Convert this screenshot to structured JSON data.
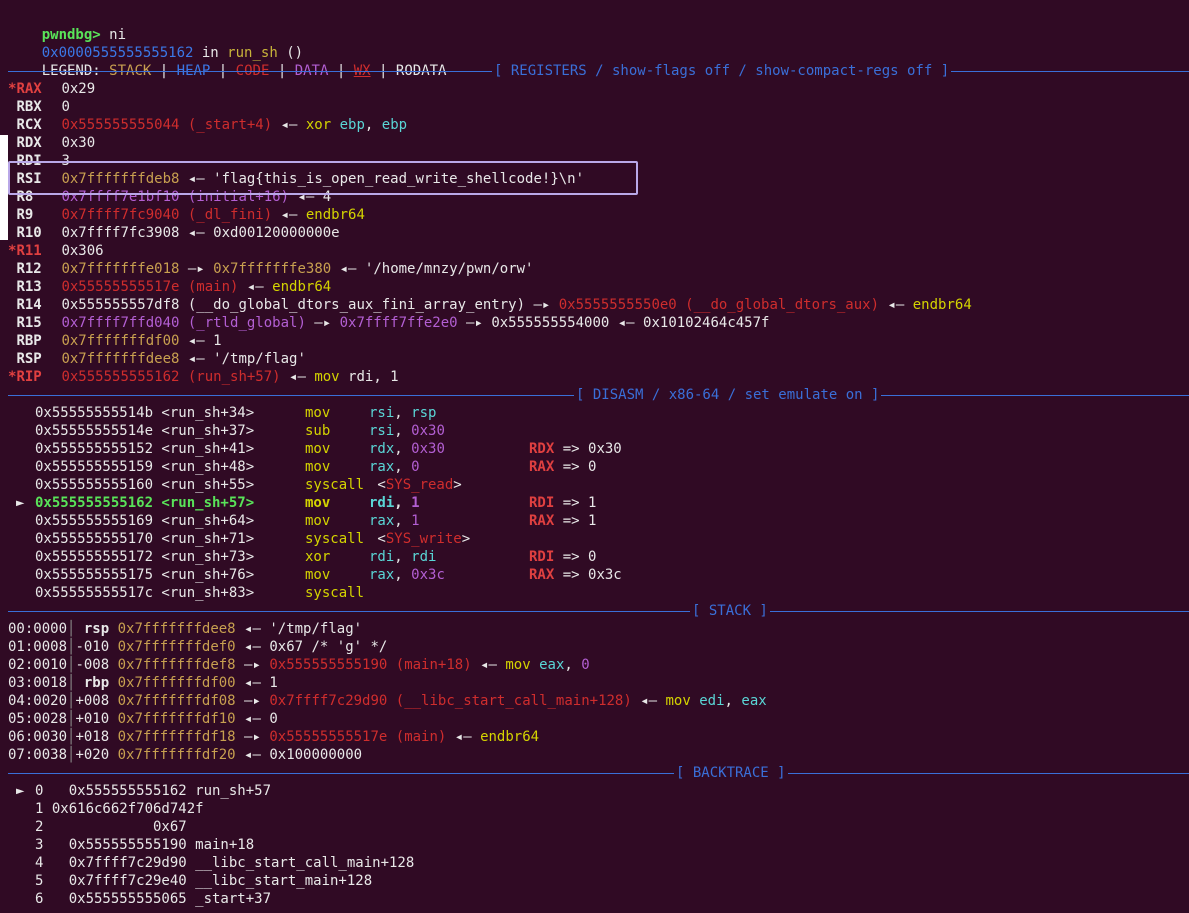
{
  "prompt": {
    "label": "pwndbg>",
    "command": "ni"
  },
  "location": {
    "addr": "0x0000555555555162",
    "in": "in",
    "func": "run_sh",
    "parens": "()"
  },
  "legend": {
    "label": "LEGEND:",
    "stack": "STACK",
    "heap": "HEAP",
    "code": "CODE",
    "data": "DATA",
    "wx": "WX",
    "rodata": "RODATA",
    "sep": "|"
  },
  "sections": {
    "registers": "[ REGISTERS / show-flags off / show-compact-regs off ]",
    "disasm": "[ DISASM / x86-64 / set emulate on ]",
    "stack": "[ STACK ]",
    "backtrace": "[ BACKTRACE ]"
  },
  "registers": [
    {
      "mark": "*",
      "name": "RAX",
      "parts": [
        {
          "t": "0x29",
          "c": ""
        }
      ]
    },
    {
      "mark": " ",
      "name": "RBX",
      "parts": [
        {
          "t": "0",
          "c": ""
        }
      ]
    },
    {
      "mark": " ",
      "name": "RCX",
      "parts": [
        {
          "t": "0x555555555044 (_start+4)",
          "c": "c-red"
        },
        {
          "t": " ◂— ",
          "c": ""
        },
        {
          "t": "xor",
          "c": "c-yellow"
        },
        {
          "t": " ",
          "c": ""
        },
        {
          "t": "ebp",
          "c": "c-cyan"
        },
        {
          "t": ", ",
          "c": ""
        },
        {
          "t": "ebp",
          "c": "c-cyan"
        }
      ]
    },
    {
      "mark": " ",
      "name": "RDX",
      "parts": [
        {
          "t": "0x30",
          "c": ""
        }
      ]
    },
    {
      "mark": " ",
      "name": "RDI",
      "parts": [
        {
          "t": "3",
          "c": ""
        }
      ]
    },
    {
      "mark": " ",
      "name": "RSI",
      "parts": [
        {
          "t": "0x7fffffffdeb8",
          "c": "c-orange"
        },
        {
          "t": " ◂— 'flag{this_is_open_read_write_shellcode!}\\n'",
          "c": ""
        }
      ]
    },
    {
      "mark": " ",
      "name": "R8",
      "parts": [
        {
          "t": "0x7ffff7e1bf10 (initial+16)",
          "c": "c-purple"
        },
        {
          "t": " ◂— 4",
          "c": ""
        }
      ]
    },
    {
      "mark": " ",
      "name": "R9",
      "parts": [
        {
          "t": "0x7ffff7fc9040 (_dl_fini)",
          "c": "c-red"
        },
        {
          "t": " ◂— ",
          "c": ""
        },
        {
          "t": "endbr64",
          "c": "c-yellow"
        }
      ]
    },
    {
      "mark": " ",
      "name": "R10",
      "parts": [
        {
          "t": "0x7ffff7fc3908 ◂— 0xd00120000000e",
          "c": ""
        }
      ]
    },
    {
      "mark": "*",
      "name": "R11",
      "parts": [
        {
          "t": "0x306",
          "c": ""
        }
      ]
    },
    {
      "mark": " ",
      "name": "R12",
      "parts": [
        {
          "t": "0x7fffffffe018",
          "c": "c-orange"
        },
        {
          "t": " —▸ ",
          "c": ""
        },
        {
          "t": "0x7fffffffe380",
          "c": "c-orange"
        },
        {
          "t": " ◂— '/home/mnzy/pwn/orw'",
          "c": ""
        }
      ]
    },
    {
      "mark": " ",
      "name": "R13",
      "parts": [
        {
          "t": "0x55555555517e (main)",
          "c": "c-red"
        },
        {
          "t": " ◂— ",
          "c": ""
        },
        {
          "t": "endbr64",
          "c": "c-yellow"
        }
      ]
    },
    {
      "mark": " ",
      "name": "R14",
      "parts": [
        {
          "t": "0x555555557df8 (__do_global_dtors_aux_fini_array_entry) —▸ ",
          "c": ""
        },
        {
          "t": "0x5555555550e0 (__do_global_dtors_aux)",
          "c": "c-red"
        },
        {
          "t": " ◂— ",
          "c": ""
        },
        {
          "t": "endbr64",
          "c": "c-yellow"
        }
      ]
    },
    {
      "mark": " ",
      "name": "R15",
      "parts": [
        {
          "t": "0x7ffff7ffd040 (_rtld_global)",
          "c": "c-purple"
        },
        {
          "t": " —▸ ",
          "c": ""
        },
        {
          "t": "0x7ffff7ffe2e0",
          "c": "c-purple"
        },
        {
          "t": " —▸ 0x555555554000 ◂— 0x10102464c457f",
          "c": ""
        }
      ]
    },
    {
      "mark": " ",
      "name": "RBP",
      "parts": [
        {
          "t": "0x7fffffffdf00",
          "c": "c-orange"
        },
        {
          "t": " ◂— 1",
          "c": ""
        }
      ]
    },
    {
      "mark": " ",
      "name": "RSP",
      "parts": [
        {
          "t": "0x7fffffffdee8",
          "c": "c-orange"
        },
        {
          "t": " ◂— '/tmp/flag'",
          "c": ""
        }
      ]
    },
    {
      "mark": "*",
      "name": "RIP",
      "parts": [
        {
          "t": "0x555555555162 (run_sh+57)",
          "c": "c-red"
        },
        {
          "t": " ◂— ",
          "c": ""
        },
        {
          "t": "mov",
          "c": "c-yellow"
        },
        {
          "t": " rdi, 1",
          "c": ""
        }
      ]
    }
  ],
  "disasm": [
    {
      "cur": false,
      "addr": "0x55555555514b <run_sh+34>",
      "op": "mov",
      "args": [
        {
          "t": "rsi",
          "c": "c-cyan"
        },
        {
          "t": ", ",
          "c": ""
        },
        {
          "t": "rsp",
          "c": "c-cyan"
        }
      ],
      "reg": "",
      "val": ""
    },
    {
      "cur": false,
      "addr": "0x55555555514e <run_sh+37>",
      "op": "sub",
      "args": [
        {
          "t": "rsi",
          "c": "c-cyan"
        },
        {
          "t": ", ",
          "c": ""
        },
        {
          "t": "0x30",
          "c": "c-purple"
        }
      ],
      "reg": "",
      "val": ""
    },
    {
      "cur": false,
      "addr": "0x555555555152 <run_sh+41>",
      "op": "mov",
      "args": [
        {
          "t": "rdx",
          "c": "c-cyan"
        },
        {
          "t": ", ",
          "c": ""
        },
        {
          "t": "0x30",
          "c": "c-purple"
        }
      ],
      "reg": "RDX",
      "val": "=> 0x30"
    },
    {
      "cur": false,
      "addr": "0x555555555159 <run_sh+48>",
      "op": "mov",
      "args": [
        {
          "t": "rax",
          "c": "c-cyan"
        },
        {
          "t": ", ",
          "c": ""
        },
        {
          "t": "0",
          "c": "c-purple"
        }
      ],
      "reg": "RAX",
      "val": "=> 0"
    },
    {
      "cur": false,
      "addr": "0x555555555160 <run_sh+55>",
      "op": "syscall",
      "args": [
        {
          "t": " <",
          "c": ""
        },
        {
          "t": "SYS_read",
          "c": "c-red"
        },
        {
          "t": ">",
          "c": ""
        }
      ],
      "reg": "",
      "val": ""
    },
    {
      "cur": true,
      "addr": "0x555555555162 <run_sh+57>",
      "op": "mov",
      "args": [
        {
          "t": "rdi",
          "c": "c-cyan b"
        },
        {
          "t": ", ",
          "c": "b"
        },
        {
          "t": "1",
          "c": "c-purple b"
        }
      ],
      "reg": "RDI",
      "val": "=> 1"
    },
    {
      "cur": false,
      "addr": "0x555555555169 <run_sh+64>",
      "op": "mov",
      "args": [
        {
          "t": "rax",
          "c": "c-cyan"
        },
        {
          "t": ", ",
          "c": ""
        },
        {
          "t": "1",
          "c": "c-purple"
        }
      ],
      "reg": "RAX",
      "val": "=> 1"
    },
    {
      "cur": false,
      "addr": "0x555555555170 <run_sh+71>",
      "op": "syscall",
      "args": [
        {
          "t": " <",
          "c": ""
        },
        {
          "t": "SYS_write",
          "c": "c-red"
        },
        {
          "t": ">",
          "c": ""
        }
      ],
      "reg": "",
      "val": ""
    },
    {
      "cur": false,
      "addr": "0x555555555172 <run_sh+73>",
      "op": "xor",
      "args": [
        {
          "t": "rdi",
          "c": "c-cyan"
        },
        {
          "t": ", ",
          "c": ""
        },
        {
          "t": "rdi",
          "c": "c-cyan"
        }
      ],
      "reg": "RDI",
      "val": "=> 0"
    },
    {
      "cur": false,
      "addr": "0x555555555175 <run_sh+76>",
      "op": "mov",
      "args": [
        {
          "t": "rax",
          "c": "c-cyan"
        },
        {
          "t": ", ",
          "c": ""
        },
        {
          "t": "0x3c",
          "c": "c-purple"
        }
      ],
      "reg": "RAX",
      "val": "=> 0x3c"
    },
    {
      "cur": false,
      "addr": "0x55555555517c <run_sh+83>",
      "op": "syscall",
      "args": [],
      "reg": "",
      "val": ""
    }
  ],
  "stack": [
    {
      "idx": "00:0000",
      "off": " rsp",
      "offBold": true,
      "parts": [
        {
          "t": "0x7fffffffdee8",
          "c": "c-orange"
        },
        {
          "t": " ◂— '/tmp/flag'",
          "c": ""
        }
      ]
    },
    {
      "idx": "01:0008",
      "off": "-010",
      "offBold": false,
      "parts": [
        {
          "t": "0x7fffffffdef0",
          "c": "c-orange"
        },
        {
          "t": " ◂— 0x67 /* 'g' */",
          "c": ""
        }
      ]
    },
    {
      "idx": "02:0010",
      "off": "-008",
      "offBold": false,
      "parts": [
        {
          "t": "0x7fffffffdef8",
          "c": "c-orange"
        },
        {
          "t": " —▸ ",
          "c": ""
        },
        {
          "t": "0x555555555190 (main+18)",
          "c": "c-red"
        },
        {
          "t": " ◂— ",
          "c": ""
        },
        {
          "t": "mov",
          "c": "c-yellow"
        },
        {
          "t": " ",
          "c": ""
        },
        {
          "t": "eax",
          "c": "c-cyan"
        },
        {
          "t": ", ",
          "c": ""
        },
        {
          "t": "0",
          "c": "c-purple"
        }
      ]
    },
    {
      "idx": "03:0018",
      "off": " rbp",
      "offBold": true,
      "parts": [
        {
          "t": "0x7fffffffdf00",
          "c": "c-orange"
        },
        {
          "t": " ◂— 1",
          "c": ""
        }
      ]
    },
    {
      "idx": "04:0020",
      "off": "+008",
      "offBold": false,
      "parts": [
        {
          "t": "0x7fffffffdf08",
          "c": "c-orange"
        },
        {
          "t": " —▸ ",
          "c": ""
        },
        {
          "t": "0x7ffff7c29d90 (__libc_start_call_main+128)",
          "c": "c-red"
        },
        {
          "t": " ◂— ",
          "c": ""
        },
        {
          "t": "mov",
          "c": "c-yellow"
        },
        {
          "t": " ",
          "c": ""
        },
        {
          "t": "edi",
          "c": "c-cyan"
        },
        {
          "t": ", ",
          "c": ""
        },
        {
          "t": "eax",
          "c": "c-cyan"
        }
      ]
    },
    {
      "idx": "05:0028",
      "off": "+010",
      "offBold": false,
      "parts": [
        {
          "t": "0x7fffffffdf10",
          "c": "c-orange"
        },
        {
          "t": " ◂— 0",
          "c": ""
        }
      ]
    },
    {
      "idx": "06:0030",
      "off": "+018",
      "offBold": false,
      "parts": [
        {
          "t": "0x7fffffffdf18",
          "c": "c-orange"
        },
        {
          "t": " —▸ ",
          "c": ""
        },
        {
          "t": "0x55555555517e (main)",
          "c": "c-red"
        },
        {
          "t": " ◂— ",
          "c": ""
        },
        {
          "t": "endbr64",
          "c": "c-yellow"
        }
      ]
    },
    {
      "idx": "07:0038",
      "off": "+020",
      "offBold": false,
      "parts": [
        {
          "t": "0x7fffffffdf20",
          "c": "c-orange"
        },
        {
          "t": " ◂— 0x100000000",
          "c": ""
        }
      ]
    }
  ],
  "backtrace": [
    {
      "cur": true,
      "text": "0   0x555555555162 run_sh+57"
    },
    {
      "cur": false,
      "text": "1 0x616c662f706d742f"
    },
    {
      "cur": false,
      "text": "2             0x67"
    },
    {
      "cur": false,
      "text": "3   0x555555555190 main+18"
    },
    {
      "cur": false,
      "text": "4   0x7ffff7c29d90 __libc_start_call_main+128"
    },
    {
      "cur": false,
      "text": "5   0x7ffff7c29e40 __libc_start_main+128"
    },
    {
      "cur": false,
      "text": "6   0x555555555065 _start+37"
    }
  ],
  "current_marker": "►"
}
